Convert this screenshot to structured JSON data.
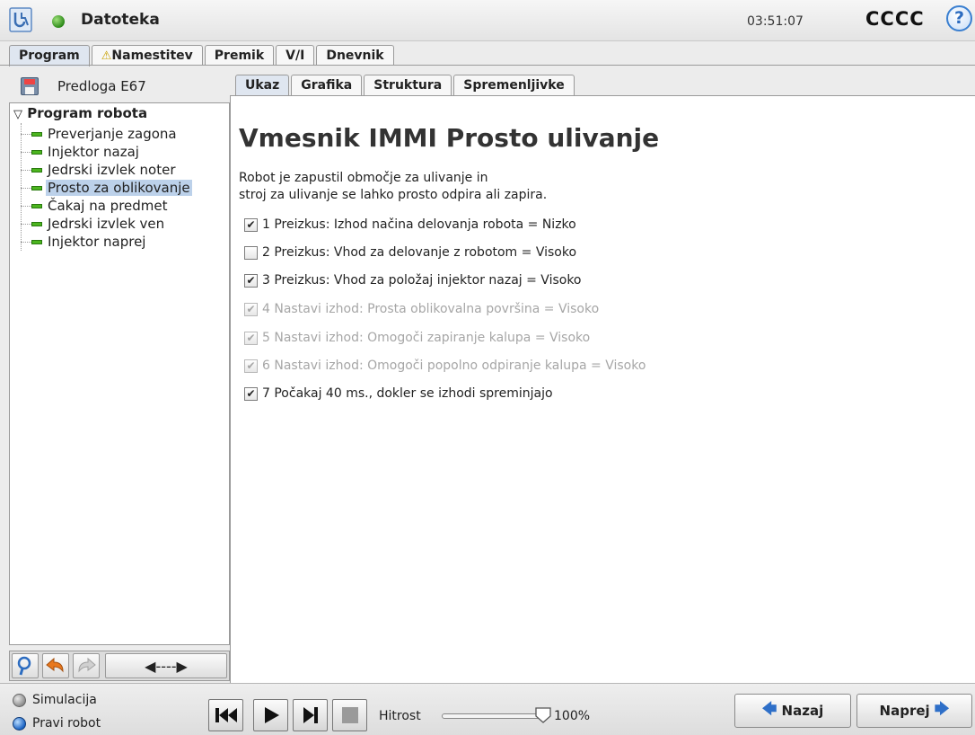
{
  "header": {
    "app_title": "Datoteka",
    "clock": "03:51:07",
    "robot_name": "CCCC",
    "help": "?"
  },
  "main_tabs": [
    {
      "label": "Program",
      "active": true
    },
    {
      "label": "Namestitev",
      "warning": true
    },
    {
      "label": "Premik"
    },
    {
      "label": "V/I"
    },
    {
      "label": "Dnevnik"
    }
  ],
  "left_panel": {
    "template_name": "Predloga E67",
    "tree": {
      "root": "Program robota",
      "items": [
        {
          "label": "Preverjanje zagona"
        },
        {
          "label": "Injektor nazaj"
        },
        {
          "label": "Jedrski izvlek noter"
        },
        {
          "label": "Prosto za oblikovanje",
          "selected": true
        },
        {
          "label": "Čakaj na predmet"
        },
        {
          "label": "Jedrski izvlek ven"
        },
        {
          "label": "Injektor naprej"
        }
      ]
    },
    "toolbar": {
      "scroll_arrows": "◀----▶"
    }
  },
  "sub_tabs": [
    {
      "label": "Ukaz",
      "active": true
    },
    {
      "label": "Grafika"
    },
    {
      "label": "Struktura"
    },
    {
      "label": "Spremenljivke"
    }
  ],
  "command": {
    "title": "Vmesnik IMMI Prosto ulivanje",
    "description_line1": "Robot je zapustil območje za ulivanje in",
    "description_line2": "stroj za ulivanje se lahko prosto odpira ali zapira.",
    "checks": [
      {
        "label": "1 Preizkus: Izhod načina delovanja robota = Nizko",
        "checked": true,
        "enabled": true
      },
      {
        "label": "2 Preizkus: Vhod za delovanje z robotom = Visoko",
        "checked": false,
        "enabled": true
      },
      {
        "label": "3 Preizkus: Vhod za položaj injektor nazaj = Visoko",
        "checked": true,
        "enabled": true
      },
      {
        "label": "4 Nastavi izhod: Prosta oblikovalna površina = Visoko",
        "checked": true,
        "enabled": false
      },
      {
        "label": "5 Nastavi izhod: Omogoči zapiranje kalupa = Visoko",
        "checked": true,
        "enabled": false
      },
      {
        "label": "6 Nastavi izhod: Omogoči popolno odpiranje kalupa = Visoko",
        "checked": true,
        "enabled": false
      },
      {
        "label": "7 Počakaj 40 ms., dokler se izhodi spreminjajo",
        "checked": true,
        "enabled": true
      }
    ]
  },
  "bottom": {
    "mode_simulation": "Simulacija",
    "mode_real": "Pravi robot",
    "selected_mode": "Pravi robot",
    "speed_label": "Hitrost",
    "speed_value": "100%",
    "speed_fraction": 1.0,
    "back_label": "Nazaj",
    "next_label": "Naprej"
  },
  "colors": {
    "selection": "#bcd1ea",
    "active_tab": "#dfe6f0",
    "node_green": "#4cb51f",
    "accent_blue": "#2e6fc8"
  }
}
